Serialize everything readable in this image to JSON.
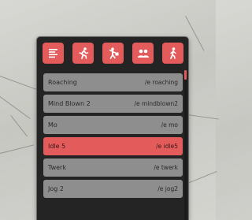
{
  "toolbar": {
    "buttons": [
      {
        "icon": "list-lines-icon"
      },
      {
        "icon": "running-person-icon"
      },
      {
        "icon": "dancing-person-icon"
      },
      {
        "icon": "group-people-icon"
      },
      {
        "icon": "walking-person-icon"
      }
    ]
  },
  "emotes": [
    {
      "name": "Roaching",
      "command": "/e roaching"
    },
    {
      "name": "Mind Blown 2",
      "command": "/e mindblown2"
    },
    {
      "name": "Mo",
      "command": "/e mo"
    },
    {
      "name": "Idle 5",
      "command": "/e idle5",
      "selected": true
    },
    {
      "name": "Twerk",
      "command": "/e twerk"
    },
    {
      "name": "Jog 2",
      "command": "/e jog2"
    }
  ],
  "colors": {
    "accent": "#e35b5b",
    "row": "#8e8e8e",
    "panel": "#242424"
  }
}
